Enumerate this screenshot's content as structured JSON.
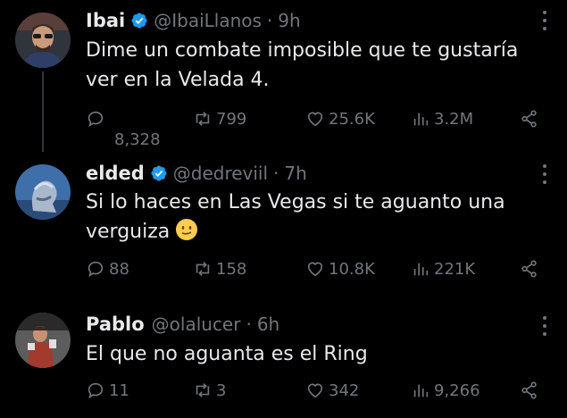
{
  "tweets": [
    {
      "name": "Ibai",
      "handle": "@IbaiLlanos",
      "separator": "·",
      "time": "9h",
      "text": "Dime un combate imposible que te gustaría ver en la Velada 4.",
      "replies": "8,328",
      "retweets": "799",
      "likes": "25.6K",
      "views": "3.2M"
    },
    {
      "name": "elded",
      "handle": "@dedreviil",
      "separator": "·",
      "time": "7h",
      "text": "Si lo haces en Las Vegas si te aguanto una verguiza",
      "emoji": "smiling-face-emoji",
      "replies": "88",
      "retweets": "158",
      "likes": "10.8K",
      "views": "221K"
    },
    {
      "name": "Pablo",
      "handle": "@olalucer",
      "separator": "·",
      "time": "6h",
      "text": "El que no aguanta es el Ring",
      "replies": "11",
      "retweets": "3",
      "likes": "342",
      "views": "9,266"
    }
  ],
  "colors": {
    "background": "#000000",
    "text": "#e7e9ea",
    "secondary": "#71767b",
    "verified": "#1d9bf0",
    "thread_line": "#333639"
  },
  "icons": [
    "reply-icon",
    "retweet-icon",
    "like-icon",
    "views-icon",
    "share-icon",
    "more-icon",
    "verified-badge-icon"
  ]
}
